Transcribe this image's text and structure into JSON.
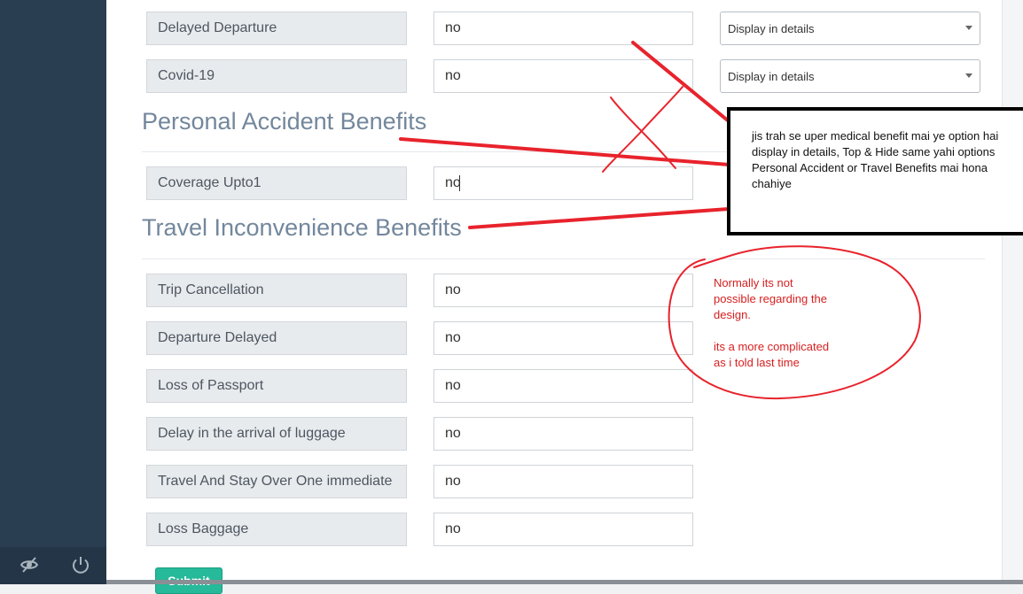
{
  "sidebar": {
    "footer_icons": [
      "eye-slash-icon",
      "power-icon"
    ]
  },
  "fields_top": [
    {
      "label": "Delayed Departure",
      "value": "no",
      "display": "Display in details"
    },
    {
      "label": "Covid-19",
      "value": "no",
      "display": "Display in details"
    }
  ],
  "personal_accident": {
    "title": "Personal Accident Benefits",
    "fields": [
      {
        "label": "Coverage Upto1",
        "value": "no"
      }
    ]
  },
  "travel_inconvenience": {
    "title": "Travel Inconvenience Benefits",
    "fields": [
      {
        "label": "Trip Cancellation",
        "value": "no"
      },
      {
        "label": "Departure Delayed",
        "value": "no"
      },
      {
        "label": "Loss of Passport",
        "value": "no"
      },
      {
        "label": "Delay in the arrival of luggage",
        "value": "no"
      },
      {
        "label": "Travel And Stay Over One immediate",
        "value": "no"
      },
      {
        "label": "Loss Baggage",
        "value": "no"
      }
    ]
  },
  "annotations": {
    "note": "jis trah se uper medical benefit mai ye option hai\ndisplay in details, Top & Hide same yahi options\nPersonal Accident or Travel Benefits mai hona\nchahiye",
    "reply": "Normally its not\npossible regarding the\ndesign.\n\nits a more complicated\nas i told last time",
    "annotation_color": "#e8232c"
  },
  "submit": {
    "label": "Submit"
  }
}
